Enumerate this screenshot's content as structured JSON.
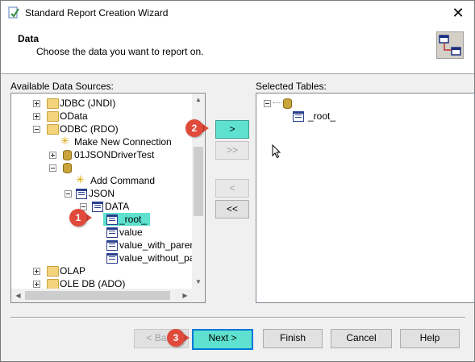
{
  "window": {
    "title": "Standard Report Creation Wizard",
    "close_label": "✕"
  },
  "header": {
    "title": "Data",
    "subtitle": "Choose the data you want to report on."
  },
  "left_panel": {
    "label": "Available Data Sources:",
    "tree": [
      {
        "label": "JDBC (JNDI)",
        "icon": "folder-icon",
        "expander": "plus"
      },
      {
        "label": "OData",
        "icon": "folder-icon",
        "expander": "plus"
      },
      {
        "label": "ODBC (RDO)",
        "icon": "folder-icon",
        "expander": "minus"
      },
      {
        "label": "Make New Connection",
        "icon": "new-connection-icon",
        "expander": "none"
      },
      {
        "label": "01JSONDriverTest",
        "icon": "database-icon",
        "expander": "plus"
      },
      {
        "label": "",
        "icon": "database-connection-icon",
        "expander": "minus"
      },
      {
        "label": "Add Command",
        "icon": "add-command-icon",
        "expander": "none"
      },
      {
        "label": "JSON",
        "icon": "schema-icon",
        "expander": "minus"
      },
      {
        "label": "DATA",
        "icon": "schema-icon",
        "expander": "minus"
      },
      {
        "label": "_root_",
        "icon": "table-icon",
        "expander": "none",
        "selected": true
      },
      {
        "label": "value",
        "icon": "table-icon",
        "expander": "none"
      },
      {
        "label": "value_with_parent",
        "icon": "table-icon",
        "expander": "none"
      },
      {
        "label": "value_without_par",
        "icon": "table-icon",
        "expander": "none"
      },
      {
        "label": "OLAP",
        "icon": "folder-icon",
        "expander": "plus"
      },
      {
        "label": "OLE DB (ADO)",
        "icon": "folder-icon",
        "expander": "plus"
      }
    ]
  },
  "transfer_buttons": {
    "add": ">",
    "add_all": ">>",
    "remove": "<",
    "remove_all": "<<"
  },
  "right_panel": {
    "label": "Selected Tables:",
    "tree": [
      {
        "label": "",
        "icon": "database-icon",
        "expander": "minus"
      },
      {
        "label": "_root_",
        "icon": "table-icon"
      }
    ]
  },
  "footer": {
    "back": "< Back",
    "next": "Next >",
    "finish": "Finish",
    "cancel": "Cancel",
    "help": "Help"
  },
  "callouts": [
    "1",
    "2",
    "3"
  ],
  "colors": {
    "highlight": "#5ee1cf",
    "callout": "#e04a3a",
    "focus_border": "#0078d7"
  }
}
